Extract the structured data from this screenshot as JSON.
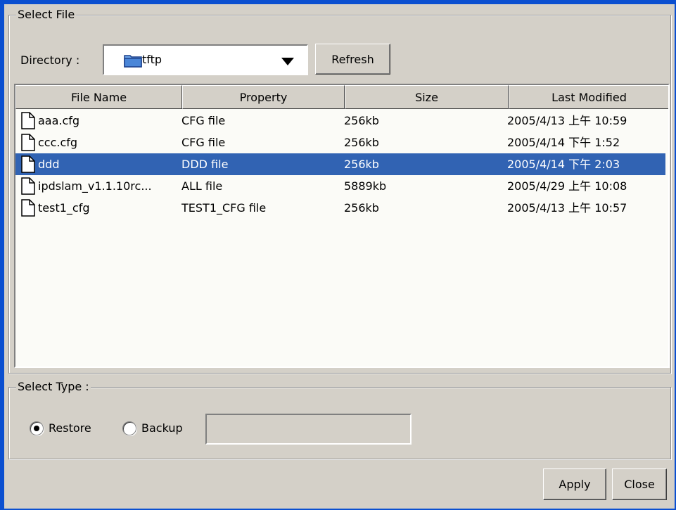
{
  "select_file": {
    "legend": "Select File",
    "directory_label": "Directory :",
    "directory_value": "tftp",
    "refresh_label": "Refresh"
  },
  "table": {
    "columns": [
      "File Name",
      "Property",
      "Size",
      "Last Modified"
    ],
    "rows": [
      {
        "name": "aaa.cfg",
        "property": "CFG file",
        "size": "256kb",
        "modified": "2005/4/13 上午 10:59",
        "selected": false
      },
      {
        "name": "ccc.cfg",
        "property": "CFG file",
        "size": "256kb",
        "modified": "2005/4/14 下午 1:52",
        "selected": false
      },
      {
        "name": "ddd",
        "property": "DDD file",
        "size": "256kb",
        "modified": "2005/4/14 下午 2:03",
        "selected": true
      },
      {
        "name": "ipdslam_v1.1.10rc...",
        "property": "ALL file",
        "size": "5889kb",
        "modified": "2005/4/29 上午 10:08",
        "selected": false
      },
      {
        "name": "test1_cfg",
        "property": "TEST1_CFG file",
        "size": "256kb",
        "modified": "2005/4/13 上午 10:57",
        "selected": false
      }
    ]
  },
  "select_type": {
    "legend": "Select Type :",
    "restore_label": "Restore",
    "backup_label": "Backup",
    "selected": "Restore",
    "backup_input_value": ""
  },
  "buttons": {
    "apply_label": "Apply",
    "close_label": "Close"
  },
  "colors": {
    "window_bg": "#d4d0c8",
    "selection_bg": "#3163b3",
    "titlebar_blue": "#0b4fd0",
    "table_bg": "#fbfbf7"
  }
}
